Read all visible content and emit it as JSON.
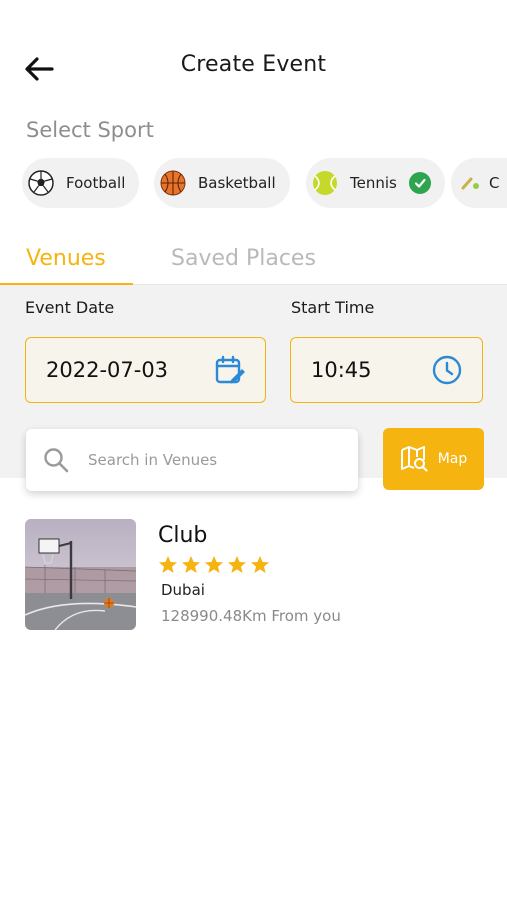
{
  "header": {
    "title": "Create Event"
  },
  "select_sport": {
    "label": "Select Sport",
    "sports": [
      {
        "label": "Football",
        "selected": false,
        "icon": "football-icon"
      },
      {
        "label": "Basketball",
        "selected": false,
        "icon": "basketball-icon"
      },
      {
        "label": "Tennis",
        "selected": true,
        "icon": "tennis-ball-icon"
      },
      {
        "label": "C",
        "selected": false,
        "icon": "cricket-icon"
      }
    ]
  },
  "tabs": [
    {
      "label": "Venues",
      "active": true
    },
    {
      "label": "Saved Places",
      "active": false
    }
  ],
  "event_date": {
    "label": "Event Date",
    "value": "2022-07-03"
  },
  "start_time": {
    "label": "Start Time",
    "value": "10:45"
  },
  "search": {
    "placeholder": "Search in Venues"
  },
  "map_button": {
    "label": "Map"
  },
  "venues": [
    {
      "name": "Club",
      "rating": 5,
      "city": "Dubai",
      "distance": "128990.48Km From you"
    }
  ],
  "colors": {
    "accent": "#f5b40f",
    "check": "#2ea44f",
    "icon_blue": "#2b8ad8"
  }
}
